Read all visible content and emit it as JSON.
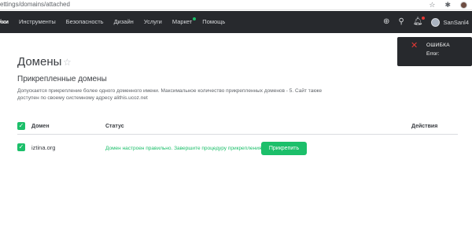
{
  "browser": {
    "address": "ettings/domains/attached"
  },
  "nav": {
    "items": [
      {
        "label": "йки"
      },
      {
        "label": "Инструменты"
      },
      {
        "label": "Безопасность"
      },
      {
        "label": "Дизайн"
      },
      {
        "label": "Услуги"
      },
      {
        "label": "Маркет"
      },
      {
        "label": "Помощь"
      }
    ],
    "user_name": "SanSanl4"
  },
  "toast": {
    "title": "ОШИБКА",
    "message": "Error:"
  },
  "page": {
    "title": "Домены",
    "subtitle": "Прикрепленные домены",
    "description": "Допускается прикрепление более одного доменного имени. Максимальное количество прикрепленных доменов - 5. Сайт также доступен по своему системному адресу alithis.ucoz.net"
  },
  "table": {
    "headers": {
      "domain": "Домен",
      "status": "Статус",
      "actions": "Действия"
    },
    "rows": [
      {
        "domain": "iztina.org",
        "status": "Домен настроен правильно. Завершите процедуру прикрепления.",
        "action": "Прикрепить"
      }
    ]
  },
  "colors": {
    "accent": "#1cbf6a",
    "nav_bg": "#27292d",
    "error": "#e53935"
  }
}
